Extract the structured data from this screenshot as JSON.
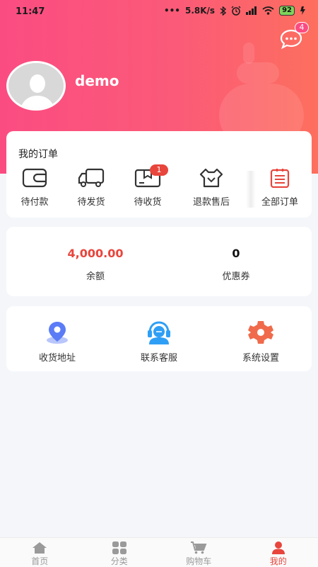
{
  "status_bar": {
    "time": "11:47",
    "network_speed": "5.8K/s",
    "battery": "92"
  },
  "messages": {
    "badge_count": "4",
    "icon": "chat-bubble-icon"
  },
  "profile": {
    "username": "demo",
    "avatar": "default-avatar"
  },
  "orders": {
    "title": "我的订单",
    "items": [
      {
        "label": "待付款",
        "icon": "wallet-icon"
      },
      {
        "label": "待发货",
        "icon": "truck-icon"
      },
      {
        "label": "待收货",
        "icon": "package-icon",
        "badge": "1"
      },
      {
        "label": "退款售后",
        "icon": "after-sale-icon"
      },
      {
        "label": "全部订单",
        "icon": "order-list-icon"
      }
    ]
  },
  "wallet": {
    "balance": {
      "value": "4,000.00",
      "label": "余额",
      "color": "#e8453c"
    },
    "coupons": {
      "value": "0",
      "label": "优惠券",
      "color": "#111111"
    }
  },
  "tools": [
    {
      "label": "收货地址",
      "icon": "location-pin-icon",
      "color": "#5b7cf6"
    },
    {
      "label": "联系客服",
      "icon": "customer-service-icon",
      "color": "#2f9ff5"
    },
    {
      "label": "系统设置",
      "icon": "gear-icon",
      "color": "#f06b4b"
    }
  ],
  "tabbar": {
    "active_index": 3,
    "accent_color": "#e8453c",
    "items": [
      {
        "label": "首页",
        "icon": "home-icon"
      },
      {
        "label": "分类",
        "icon": "category-grid-icon"
      },
      {
        "label": "购物车",
        "icon": "cart-icon"
      },
      {
        "label": "我的",
        "icon": "person-icon"
      }
    ]
  }
}
